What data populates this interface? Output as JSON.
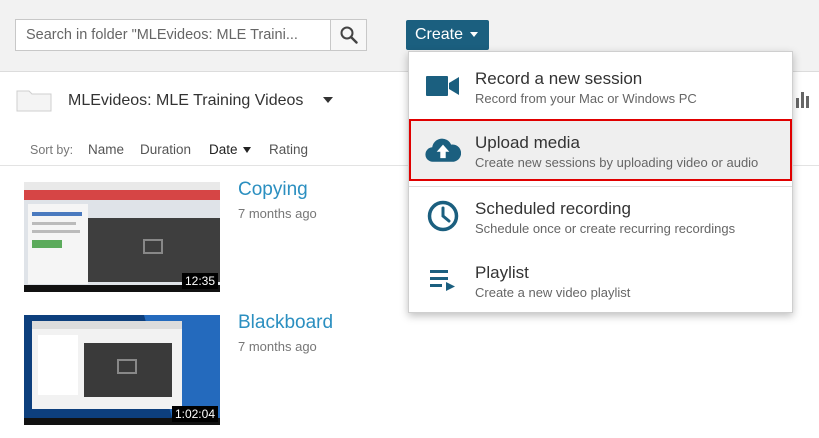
{
  "search": {
    "placeholder": "Search in folder \"MLEvideos: MLE Training Videos\"",
    "display": "Search in folder \"MLEvideos: MLE Traini..."
  },
  "toolbar": {
    "create_label": "Create"
  },
  "folder": {
    "name": "MLEvideos: MLE Training Videos"
  },
  "sort": {
    "label": "Sort by:",
    "options": [
      "Name",
      "Duration",
      "Date",
      "Rating"
    ],
    "active": "Date"
  },
  "sessions": [
    {
      "title": "Copying",
      "date": "7 months ago",
      "duration": "12:35"
    },
    {
      "title": "Blackboard",
      "date": "7 months ago",
      "duration": "1:02:04"
    }
  ],
  "create_menu": {
    "items": [
      {
        "title": "Record a new session",
        "subtitle": "Record from your Mac or Windows PC",
        "icon": "video-camera-icon"
      },
      {
        "title": "Upload media",
        "subtitle": "Create new sessions by uploading video or audio",
        "icon": "cloud-upload-icon",
        "highlighted": true
      },
      {
        "title": "Scheduled recording",
        "subtitle": "Schedule once or create recurring recordings",
        "icon": "clock-icon"
      },
      {
        "title": "Playlist",
        "subtitle": "Create a new video playlist",
        "icon": "playlist-icon"
      }
    ]
  },
  "colors": {
    "brand": "#1b5f7f",
    "link": "#2b8fc0",
    "highlight_border": "#e00000"
  }
}
